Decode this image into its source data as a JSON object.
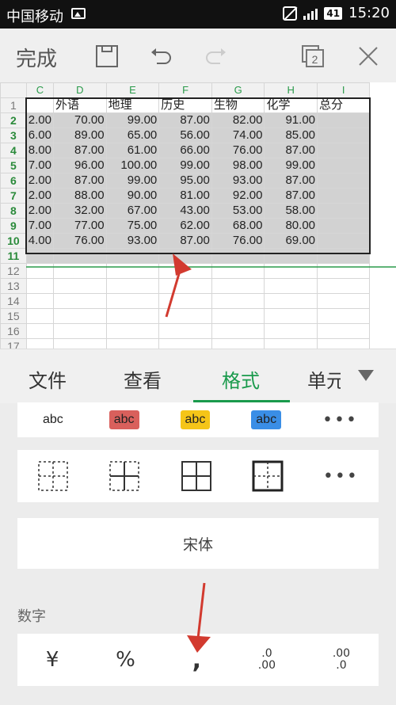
{
  "status": {
    "carrier": "中国移动",
    "battery": "41",
    "time": "15:20"
  },
  "toolbar": {
    "done_label": "完成",
    "layers_count": "2"
  },
  "sheet": {
    "col_headers": [
      "C",
      "D",
      "E",
      "F",
      "G",
      "H",
      "I"
    ],
    "header_row": {
      "row_no": "1",
      "cells": [
        "",
        "外语",
        "地理",
        "历史",
        "生物",
        "化学",
        "总分"
      ]
    },
    "rows": [
      {
        "row_no": "2",
        "cells": [
          "2.00",
          "70.00",
          "99.00",
          "87.00",
          "82.00",
          "91.00",
          ""
        ]
      },
      {
        "row_no": "3",
        "cells": [
          "6.00",
          "89.00",
          "65.00",
          "56.00",
          "74.00",
          "85.00",
          ""
        ]
      },
      {
        "row_no": "4",
        "cells": [
          "8.00",
          "87.00",
          "61.00",
          "66.00",
          "76.00",
          "87.00",
          ""
        ]
      },
      {
        "row_no": "5",
        "cells": [
          "7.00",
          "96.00",
          "100.00",
          "99.00",
          "98.00",
          "99.00",
          ""
        ]
      },
      {
        "row_no": "6",
        "cells": [
          "2.00",
          "87.00",
          "99.00",
          "95.00",
          "93.00",
          "87.00",
          ""
        ]
      },
      {
        "row_no": "7",
        "cells": [
          "2.00",
          "88.00",
          "90.00",
          "81.00",
          "92.00",
          "87.00",
          ""
        ]
      },
      {
        "row_no": "8",
        "cells": [
          "2.00",
          "32.00",
          "67.00",
          "43.00",
          "53.00",
          "58.00",
          ""
        ]
      },
      {
        "row_no": "9",
        "cells": [
          "7.00",
          "77.00",
          "75.00",
          "62.00",
          "68.00",
          "80.00",
          ""
        ]
      },
      {
        "row_no": "10",
        "cells": [
          "4.00",
          "76.00",
          "93.00",
          "87.00",
          "76.00",
          "69.00",
          ""
        ]
      }
    ],
    "empty_rows": [
      "11",
      "12",
      "13",
      "14",
      "15",
      "16",
      "17"
    ]
  },
  "tabs": [
    {
      "label": "文件"
    },
    {
      "label": "查看"
    },
    {
      "label": "格式"
    },
    {
      "label": "单元"
    }
  ],
  "text_styles": [
    {
      "label": "abc",
      "bg": "#ffffff",
      "color": "#222222"
    },
    {
      "label": "abc",
      "bg": "#d9605c",
      "color": "#222222"
    },
    {
      "label": "abc",
      "bg": "#f5c518",
      "color": "#222222"
    },
    {
      "label": "abc",
      "bg": "#3a8ee6",
      "color": "#222222"
    }
  ],
  "font_name": "宋体",
  "number_section": {
    "label": "数字",
    "buttons": [
      {
        "label": "¥",
        "icon": "currency-icon"
      },
      {
        "label": "%",
        "icon": "percent-icon"
      },
      {
        "label": ",",
        "icon": "thousands-separator-icon"
      },
      {
        "label": ".0 .00",
        "icon": "increase-decimal-icon"
      },
      {
        "label": ".00 .0",
        "icon": "decrease-decimal-icon"
      }
    ]
  },
  "colors": {
    "accent": "#1a9a4c",
    "arrow": "#d23a2f",
    "selection": "#d2d2d2"
  }
}
